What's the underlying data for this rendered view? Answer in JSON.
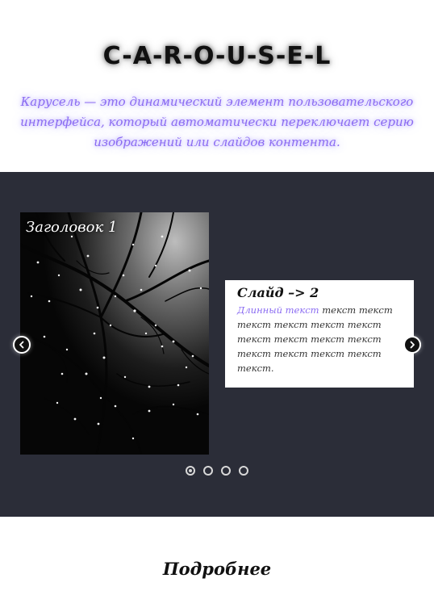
{
  "header": {
    "title": "C-A-R-O-U-S-E-L",
    "description": "Карусель — это динамический элемент пользовательского интерфейса, который автоматически переключает серию изображений или слайдов контента."
  },
  "carousel": {
    "photo_slide": {
      "heading": "Заголовок 1",
      "image": "night-branches-with-raindrops"
    },
    "text_slide": {
      "title": "Слайд –> 2",
      "highlight": "Длинный текст",
      "body": " текст текст текст текст текст текст текст текст текст текст текст текст текст текст текст."
    },
    "prev_icon": "chevron-left-icon",
    "next_icon": "chevron-right-icon",
    "dots": [
      {
        "active": true
      },
      {
        "active": false
      },
      {
        "active": false
      },
      {
        "active": false
      }
    ],
    "colors": {
      "background": "#2b2d38",
      "accent": "#8a6bf2"
    }
  },
  "footer": {
    "more_label": "Подробнее"
  }
}
